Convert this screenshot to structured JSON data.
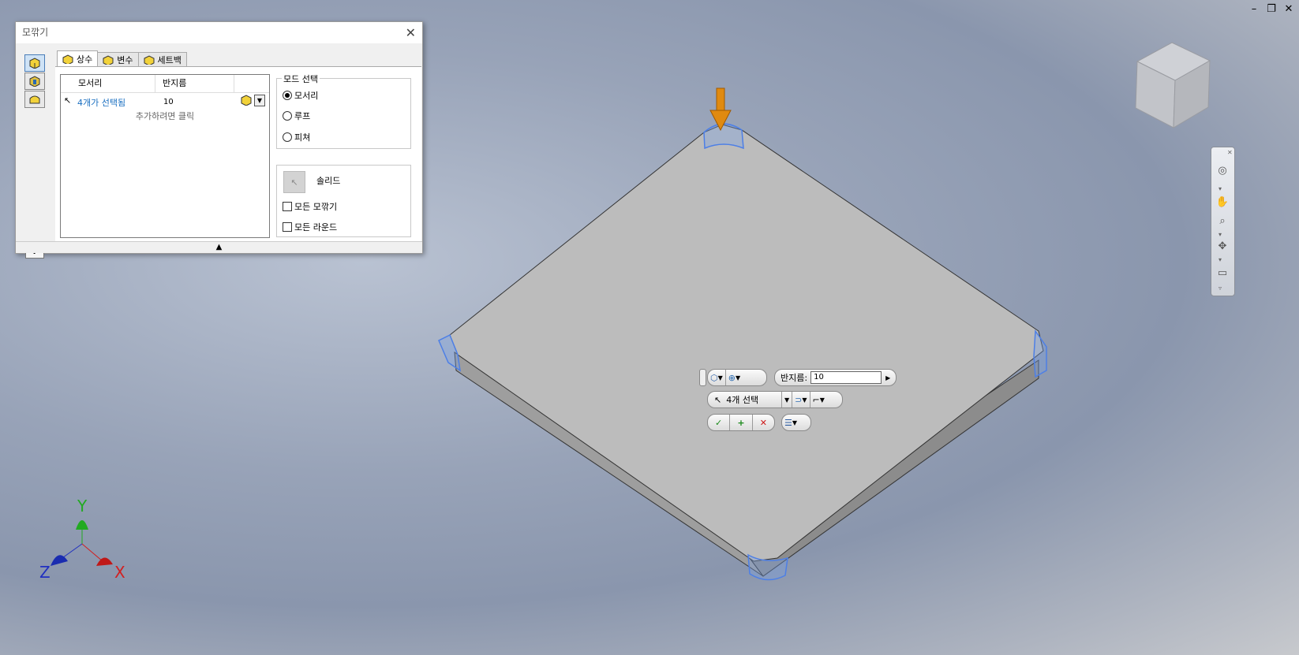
{
  "window_controls": [
    "–",
    "❐",
    "✕"
  ],
  "dialog": {
    "title": "모깎기",
    "close": "✕",
    "tabs": [
      {
        "label": "상수",
        "active": true
      },
      {
        "label": "변수",
        "active": false
      },
      {
        "label": "세트백",
        "active": false
      }
    ],
    "grid": {
      "columns": [
        "모서리",
        "반지름"
      ],
      "rows": [
        {
          "edge": "4개가 선택됨",
          "radius": "10"
        }
      ],
      "add_row": "추가하려면 클릭"
    },
    "mode_group": {
      "title": "모드 선택",
      "options": [
        {
          "label": "모서리",
          "selected": true
        },
        {
          "label": "루프",
          "selected": false
        },
        {
          "label": "피쳐",
          "selected": false
        }
      ]
    },
    "solid_label": "솔리드",
    "checkboxes": [
      {
        "label": "모든 모깎기",
        "checked": false
      },
      {
        "label": "모든 라운드",
        "checked": false
      }
    ],
    "help": "?",
    "expand": "▲"
  },
  "mini_toolbar": {
    "radius_label": "반지름:",
    "radius_value": "10",
    "selection_label": "4개 선택"
  },
  "axes": {
    "x": "X",
    "y": "Y",
    "z": "Z"
  },
  "colors": {
    "accent_blue": "#1a6fc0",
    "plate_top": "#bcbcbc",
    "axis_x": "#d22020",
    "axis_y": "#22aa22",
    "axis_z": "#2030c0",
    "arrow": "#e08a10"
  },
  "icons": [
    "cube-icon",
    "dropdown-icon",
    "cursor-icon",
    "check-icon",
    "plus-icon",
    "cancel-icon",
    "list-icon",
    "orbit-icon",
    "pan-icon",
    "zoom-icon",
    "look-icon",
    "home-icon"
  ]
}
